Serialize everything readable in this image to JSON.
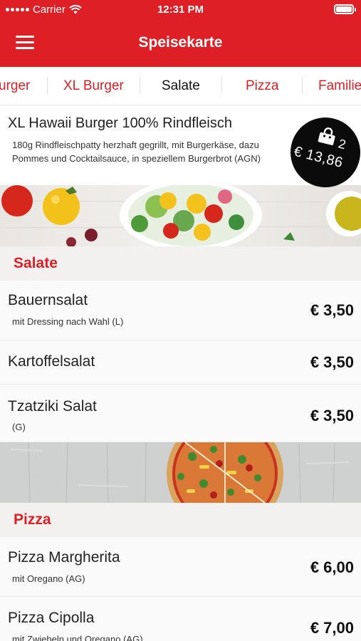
{
  "status": {
    "carrier": "Carrier",
    "time": "12:31 PM"
  },
  "header": {
    "title": "Speisekarte"
  },
  "tabs": [
    {
      "label": "urger"
    },
    {
      "label": "XL Burger"
    },
    {
      "label": "Salate"
    },
    {
      "label": "Pizza"
    },
    {
      "label": "Familie"
    }
  ],
  "featured": {
    "name": "XL Hawaii Burger 100% Rindfleisch",
    "description": "180g Rindfleischpatty herzhaft gegrillt, mit Burgerkäse, dazu Pommes und Cocktailsauce, in speziellem Burgerbrot (AGN)"
  },
  "cart": {
    "count": "2",
    "total": "€ 13,86"
  },
  "sections": {
    "salate": {
      "title": "Salate",
      "items": [
        {
          "name": "Bauernsalat",
          "desc": "mit Dressing nach Wahl (L)",
          "price": "€ 3,50"
        },
        {
          "name": "Kartoffelsalat",
          "desc": "",
          "price": "€ 3,50"
        },
        {
          "name": "Tzatziki Salat",
          "desc": "(G)",
          "price": "€ 3,50"
        }
      ]
    },
    "pizza": {
      "title": "Pizza",
      "items": [
        {
          "name": "Pizza Margherita",
          "desc": "mit Oregano (AG)",
          "price": "€ 6,00"
        },
        {
          "name": "Pizza Cipolla",
          "desc": "mit Zwiebeln und Oregano (AG)",
          "price": "€ 7,00"
        }
      ]
    }
  },
  "colors": {
    "brand": "#df1f26",
    "header_text": "#ffffff",
    "badge": "#0b0b0b"
  },
  "icons": {
    "menu": "hamburger-menu-icon",
    "cart": "shopping-bag-icon",
    "wifi": "wifi-icon",
    "battery": "battery-icon"
  }
}
